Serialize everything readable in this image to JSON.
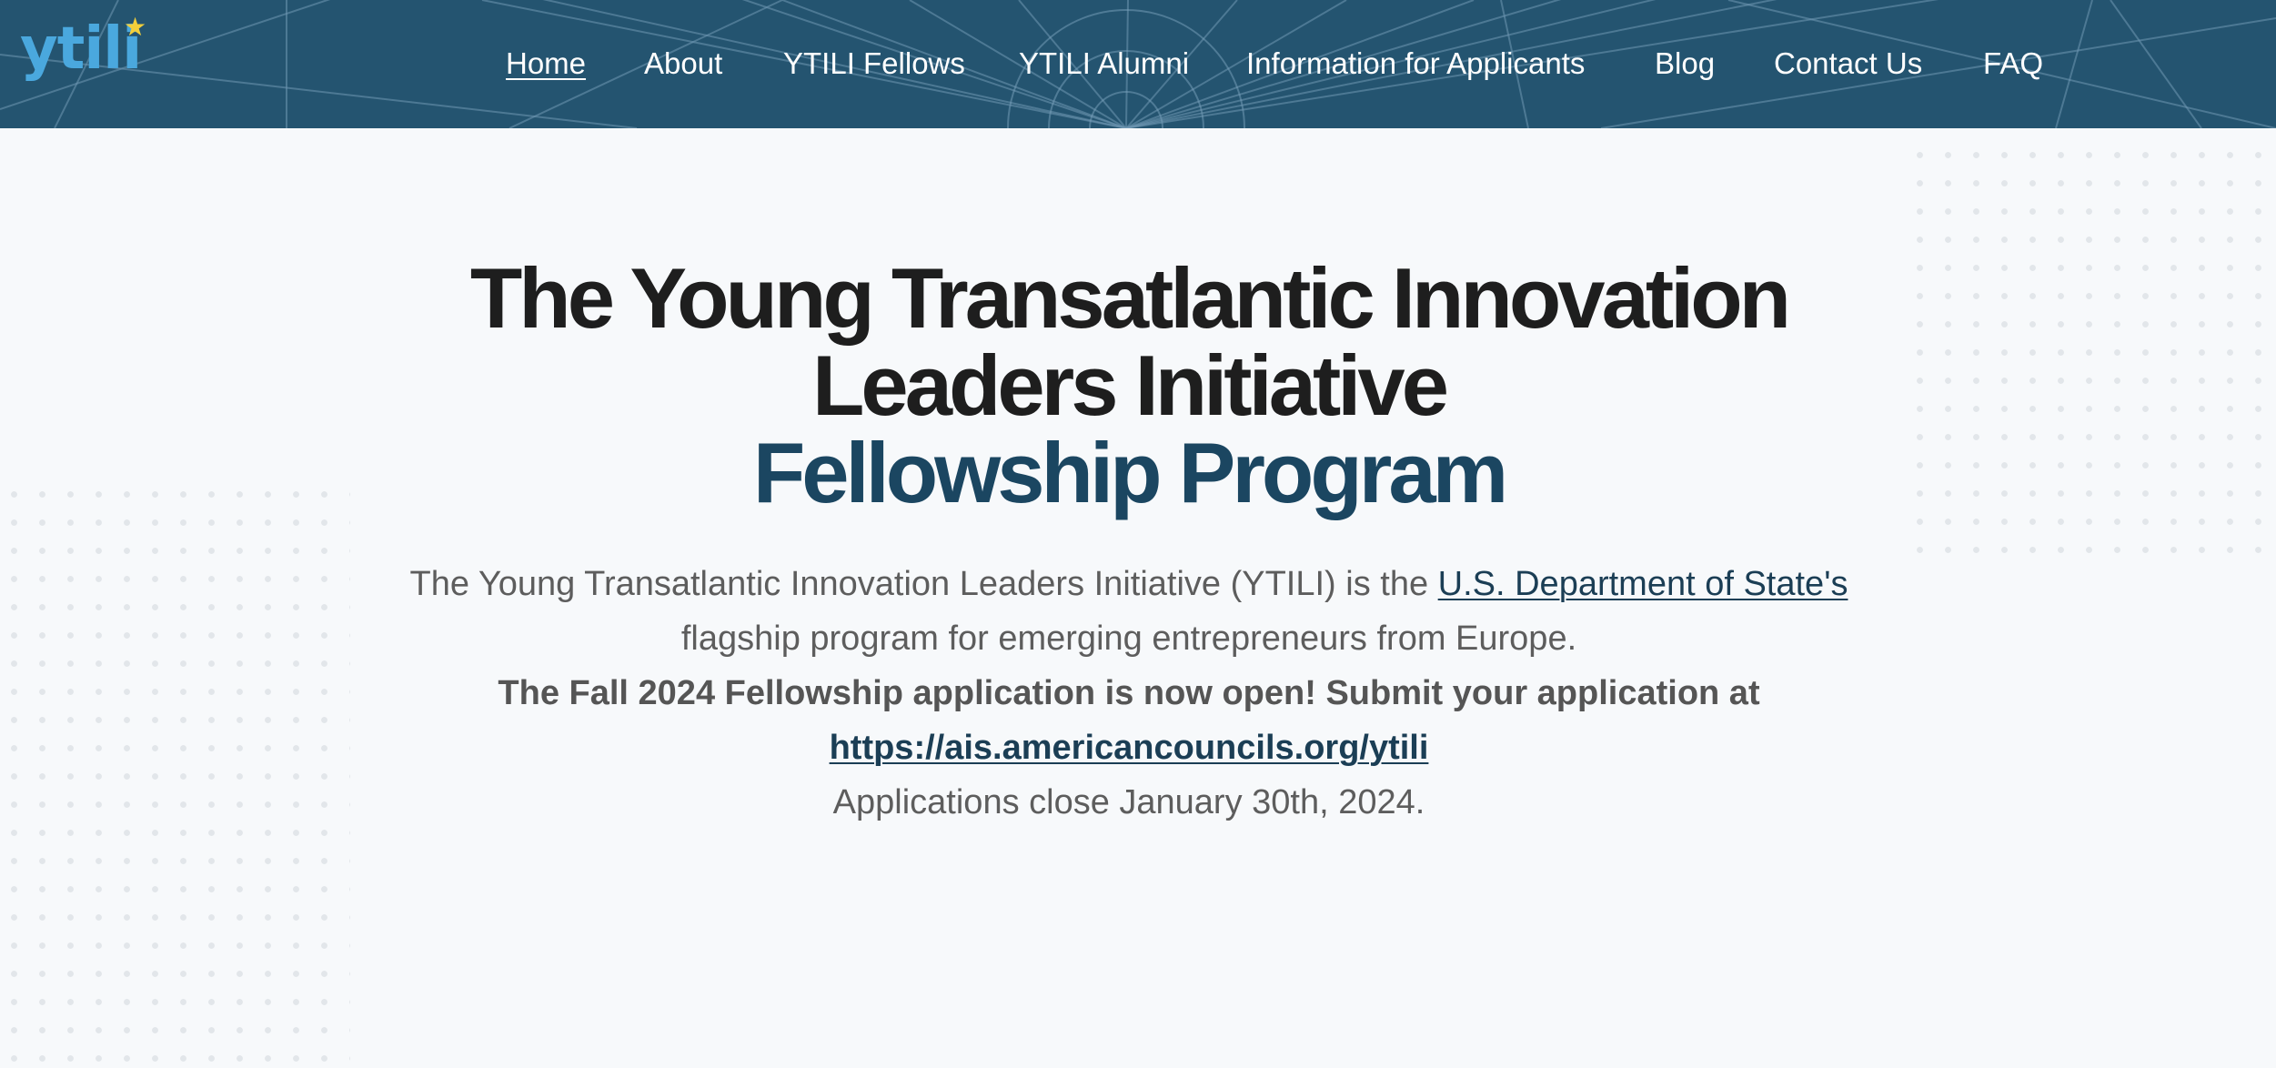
{
  "header": {
    "logo_text": "ytili",
    "colors": {
      "background": "#245470",
      "logo": "#4aa8de",
      "star": "#f2cf3a"
    },
    "nav": [
      {
        "label": "Home",
        "active": true
      },
      {
        "label": "About",
        "active": false
      },
      {
        "label": "YTILI Fellows",
        "active": false
      },
      {
        "label": "YTILI Alumni",
        "active": false
      },
      {
        "label": "Information for Applicants",
        "active": false
      },
      {
        "label": "Blog",
        "active": false
      },
      {
        "label": "Contact Us",
        "active": false
      },
      {
        "label": "FAQ",
        "active": false
      }
    ]
  },
  "hero": {
    "title_line1": "The Young Transatlantic Innovation",
    "title_line2": "Leaders Initiative",
    "title_line3": "Fellowship Program",
    "intro_before_link": "The Young Transatlantic Innovation Leaders Initiative (YTILI) is the ",
    "intro_link": "U.S. Department of State's",
    "intro_after_link": " flagship program for emerging entrepreneurs from Europe.",
    "announcement": "The Fall 2024 Fellowship application is now open! Submit your application at",
    "application_link": "https://ais.americancouncils.org/ytili",
    "deadline": "Applications close January 30th, 2024.",
    "colors": {
      "title": "#1e1e1e",
      "accent": "#1b4661",
      "body": "#5d5d5d",
      "link": "#1b3e55",
      "page_background": "#f7f9fb"
    }
  }
}
